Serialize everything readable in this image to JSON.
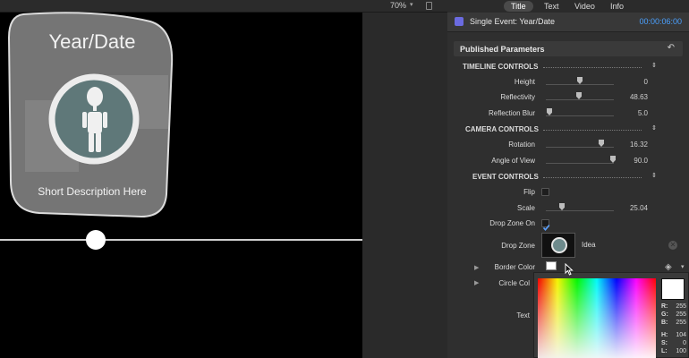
{
  "viewer": {
    "zoom": "70%",
    "zoom_caret": "▾",
    "card": {
      "title": "Year/Date",
      "description": "Short Description Here"
    }
  },
  "inspector": {
    "tabs": [
      {
        "label": "Title"
      },
      {
        "label": "Text"
      },
      {
        "label": "Video"
      },
      {
        "label": "Info"
      }
    ],
    "active_tab": "Title",
    "event_title": "Single Event: Year/Date",
    "timecode": "00:00:06:00",
    "published_label": "Published Parameters",
    "reset_glyph": "↶",
    "sections": {
      "timeline": "TIMELINE CONTROLS",
      "camera": "CAMERA CONTROLS",
      "event": "EVENT CONTROLS"
    },
    "params": {
      "height": {
        "label": "Height",
        "value": "0",
        "level": 0.5
      },
      "reflectivity": {
        "label": "Reflectivity",
        "value": "48.63",
        "level": 0.4863
      },
      "reflection_blur": {
        "label": "Reflection Blur",
        "value": "5.0",
        "level": 0.05
      },
      "rotation": {
        "label": "Rotation",
        "value": "16.32",
        "level": 0.85
      },
      "angle_of_view": {
        "label": "Angle of View",
        "value": "90.0",
        "level": 1.0
      },
      "flip": {
        "label": "Flip",
        "checked": false
      },
      "scale": {
        "label": "Scale",
        "value": "25.04",
        "level": 0.2
      },
      "drop_zone_on": {
        "label": "Drop Zone On",
        "checked": true
      },
      "drop_zone": {
        "label": "Drop Zone",
        "name": "Idea"
      },
      "border_color": {
        "label": "Border Color"
      },
      "circle_color": {
        "label": "Circle Col"
      },
      "text_color": {
        "label": "Text"
      }
    },
    "picker": {
      "r": {
        "label": "R:",
        "value": "255"
      },
      "g": {
        "label": "G:",
        "value": "255"
      },
      "b": {
        "label": "B:",
        "value": "255"
      },
      "h": {
        "label": "H:",
        "value": "104"
      },
      "s": {
        "label": "S:",
        "value": "0"
      },
      "l": {
        "label": "L:",
        "value": "100"
      }
    },
    "colors": {
      "accent": "#4aa0ff",
      "panel": "#2f2f2f"
    }
  }
}
